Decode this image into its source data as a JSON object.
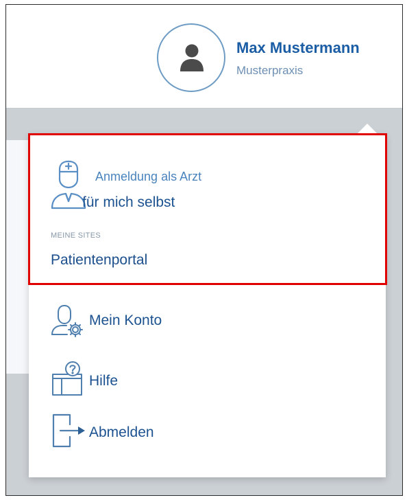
{
  "header": {
    "user_name": "Max Mustermann",
    "organization": "Musterpraxis",
    "avatar_icon": "user-silhouette-icon"
  },
  "menu": {
    "role": {
      "icon": "doctor-icon",
      "title": "Anmeldung als Arzt",
      "subtitle": "für mich selbst"
    },
    "sites_heading": "MEINE SITES",
    "sites": [
      "Patientenportal"
    ],
    "items": [
      {
        "icon": "account-settings-icon",
        "label": "Mein Konto"
      },
      {
        "icon": "help-icon",
        "label": "Hilfe"
      },
      {
        "icon": "logout-icon",
        "label": "Abmelden"
      }
    ],
    "highlight_color": "#e00000"
  },
  "colors": {
    "primary_blue": "#1a5da5",
    "light_blue": "#6e9cc4",
    "backdrop": "#cbd0d5"
  }
}
